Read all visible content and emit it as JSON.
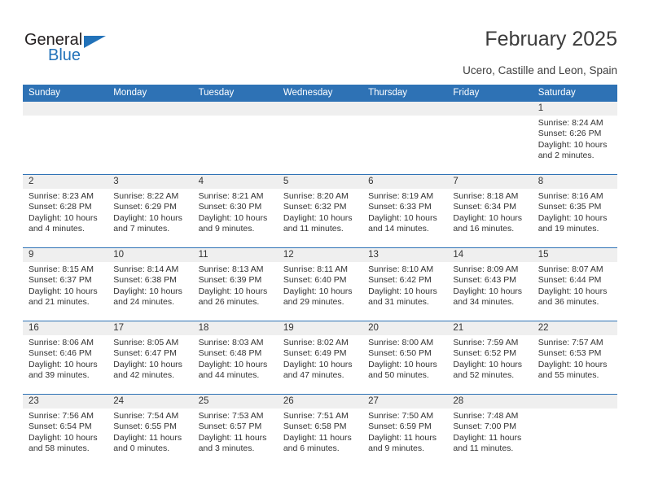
{
  "brand": {
    "name_part1": "General",
    "name_part2": "Blue",
    "triangle_icon": "triangle-icon",
    "colors": {
      "blue": "#2272b9",
      "dark": "#231f20"
    }
  },
  "header": {
    "title": "February 2025",
    "subtitle": "Ucero, Castille and Leon, Spain"
  },
  "calendar": {
    "header_bg": "#2e72b5",
    "numband_bg": "#efefef",
    "weekdays": [
      "Sunday",
      "Monday",
      "Tuesday",
      "Wednesday",
      "Thursday",
      "Friday",
      "Saturday"
    ],
    "weeks": [
      [
        {
          "day": ""
        },
        {
          "day": ""
        },
        {
          "day": ""
        },
        {
          "day": ""
        },
        {
          "day": ""
        },
        {
          "day": ""
        },
        {
          "day": "1",
          "sunrise": "Sunrise: 8:24 AM",
          "sunset": "Sunset: 6:26 PM",
          "daylight": "Daylight: 10 hours and 2 minutes."
        }
      ],
      [
        {
          "day": "2",
          "sunrise": "Sunrise: 8:23 AM",
          "sunset": "Sunset: 6:28 PM",
          "daylight": "Daylight: 10 hours and 4 minutes."
        },
        {
          "day": "3",
          "sunrise": "Sunrise: 8:22 AM",
          "sunset": "Sunset: 6:29 PM",
          "daylight": "Daylight: 10 hours and 7 minutes."
        },
        {
          "day": "4",
          "sunrise": "Sunrise: 8:21 AM",
          "sunset": "Sunset: 6:30 PM",
          "daylight": "Daylight: 10 hours and 9 minutes."
        },
        {
          "day": "5",
          "sunrise": "Sunrise: 8:20 AM",
          "sunset": "Sunset: 6:32 PM",
          "daylight": "Daylight: 10 hours and 11 minutes."
        },
        {
          "day": "6",
          "sunrise": "Sunrise: 8:19 AM",
          "sunset": "Sunset: 6:33 PM",
          "daylight": "Daylight: 10 hours and 14 minutes."
        },
        {
          "day": "7",
          "sunrise": "Sunrise: 8:18 AM",
          "sunset": "Sunset: 6:34 PM",
          "daylight": "Daylight: 10 hours and 16 minutes."
        },
        {
          "day": "8",
          "sunrise": "Sunrise: 8:16 AM",
          "sunset": "Sunset: 6:35 PM",
          "daylight": "Daylight: 10 hours and 19 minutes."
        }
      ],
      [
        {
          "day": "9",
          "sunrise": "Sunrise: 8:15 AM",
          "sunset": "Sunset: 6:37 PM",
          "daylight": "Daylight: 10 hours and 21 minutes."
        },
        {
          "day": "10",
          "sunrise": "Sunrise: 8:14 AM",
          "sunset": "Sunset: 6:38 PM",
          "daylight": "Daylight: 10 hours and 24 minutes."
        },
        {
          "day": "11",
          "sunrise": "Sunrise: 8:13 AM",
          "sunset": "Sunset: 6:39 PM",
          "daylight": "Daylight: 10 hours and 26 minutes."
        },
        {
          "day": "12",
          "sunrise": "Sunrise: 8:11 AM",
          "sunset": "Sunset: 6:40 PM",
          "daylight": "Daylight: 10 hours and 29 minutes."
        },
        {
          "day": "13",
          "sunrise": "Sunrise: 8:10 AM",
          "sunset": "Sunset: 6:42 PM",
          "daylight": "Daylight: 10 hours and 31 minutes."
        },
        {
          "day": "14",
          "sunrise": "Sunrise: 8:09 AM",
          "sunset": "Sunset: 6:43 PM",
          "daylight": "Daylight: 10 hours and 34 minutes."
        },
        {
          "day": "15",
          "sunrise": "Sunrise: 8:07 AM",
          "sunset": "Sunset: 6:44 PM",
          "daylight": "Daylight: 10 hours and 36 minutes."
        }
      ],
      [
        {
          "day": "16",
          "sunrise": "Sunrise: 8:06 AM",
          "sunset": "Sunset: 6:46 PM",
          "daylight": "Daylight: 10 hours and 39 minutes."
        },
        {
          "day": "17",
          "sunrise": "Sunrise: 8:05 AM",
          "sunset": "Sunset: 6:47 PM",
          "daylight": "Daylight: 10 hours and 42 minutes."
        },
        {
          "day": "18",
          "sunrise": "Sunrise: 8:03 AM",
          "sunset": "Sunset: 6:48 PM",
          "daylight": "Daylight: 10 hours and 44 minutes."
        },
        {
          "day": "19",
          "sunrise": "Sunrise: 8:02 AM",
          "sunset": "Sunset: 6:49 PM",
          "daylight": "Daylight: 10 hours and 47 minutes."
        },
        {
          "day": "20",
          "sunrise": "Sunrise: 8:00 AM",
          "sunset": "Sunset: 6:50 PM",
          "daylight": "Daylight: 10 hours and 50 minutes."
        },
        {
          "day": "21",
          "sunrise": "Sunrise: 7:59 AM",
          "sunset": "Sunset: 6:52 PM",
          "daylight": "Daylight: 10 hours and 52 minutes."
        },
        {
          "day": "22",
          "sunrise": "Sunrise: 7:57 AM",
          "sunset": "Sunset: 6:53 PM",
          "daylight": "Daylight: 10 hours and 55 minutes."
        }
      ],
      [
        {
          "day": "23",
          "sunrise": "Sunrise: 7:56 AM",
          "sunset": "Sunset: 6:54 PM",
          "daylight": "Daylight: 10 hours and 58 minutes."
        },
        {
          "day": "24",
          "sunrise": "Sunrise: 7:54 AM",
          "sunset": "Sunset: 6:55 PM",
          "daylight": "Daylight: 11 hours and 0 minutes."
        },
        {
          "day": "25",
          "sunrise": "Sunrise: 7:53 AM",
          "sunset": "Sunset: 6:57 PM",
          "daylight": "Daylight: 11 hours and 3 minutes."
        },
        {
          "day": "26",
          "sunrise": "Sunrise: 7:51 AM",
          "sunset": "Sunset: 6:58 PM",
          "daylight": "Daylight: 11 hours and 6 minutes."
        },
        {
          "day": "27",
          "sunrise": "Sunrise: 7:50 AM",
          "sunset": "Sunset: 6:59 PM",
          "daylight": "Daylight: 11 hours and 9 minutes."
        },
        {
          "day": "28",
          "sunrise": "Sunrise: 7:48 AM",
          "sunset": "Sunset: 7:00 PM",
          "daylight": "Daylight: 11 hours and 11 minutes."
        },
        {
          "day": ""
        }
      ]
    ]
  }
}
